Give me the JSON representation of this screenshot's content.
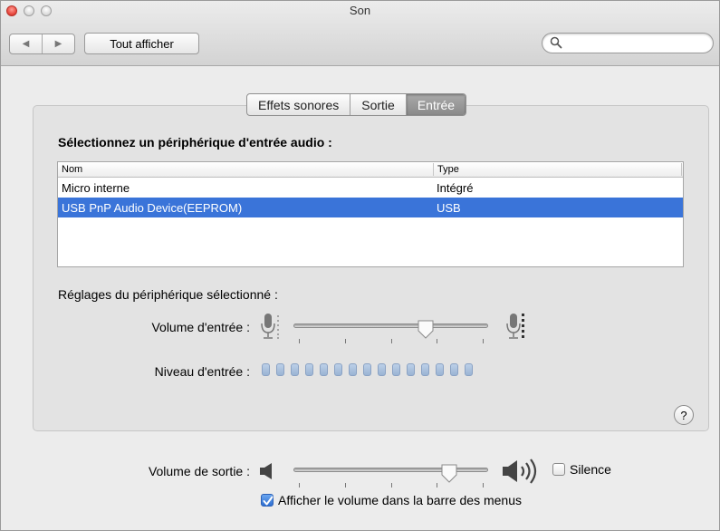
{
  "window": {
    "title": "Son"
  },
  "toolbar": {
    "back_label": "◀",
    "forward_label": "▶",
    "show_all_label": "Tout afficher",
    "search_value": "",
    "search_placeholder": ""
  },
  "tabs": [
    {
      "label": "Effets sonores",
      "active": false
    },
    {
      "label": "Sortie",
      "active": false
    },
    {
      "label": "Entrée",
      "active": true
    }
  ],
  "input": {
    "heading": "Sélectionnez un périphérique d'entrée audio :",
    "columns": [
      "Nom",
      "Type"
    ],
    "devices": [
      {
        "name": "Micro interne",
        "type": "Intégré",
        "selected": false
      },
      {
        "name": "USB PnP Audio Device(EEPROM)",
        "type": "USB",
        "selected": true
      }
    ],
    "settings_label": "Réglages du périphérique sélectionné :",
    "volume_label": "Volume d'entrée :",
    "volume_level": 0.68,
    "level_label": "Niveau d'entrée :",
    "level_segments": 15,
    "level_active": 0
  },
  "output": {
    "volume_label": "Volume de sortie :",
    "volume_level": 0.8,
    "mute_label": "Silence",
    "mute_checked": false,
    "show_in_menubar_label": "Afficher le volume dans la barre des menus",
    "show_in_menubar_checked": true
  },
  "help_label": "?",
  "colors": {
    "selection": "#3a74d9",
    "active_tab": "#8e8e8e",
    "meter_led": "#a9bfdc"
  }
}
